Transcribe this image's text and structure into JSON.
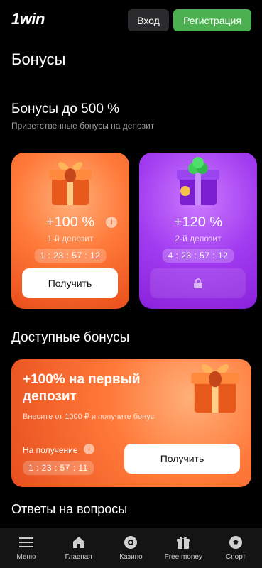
{
  "header": {
    "logo": "1win",
    "login_label": "Вход",
    "register_label": "Регистрация"
  },
  "page_title": "Бонусы",
  "welcome": {
    "title": "Бонусы до 500 %",
    "subtitle": "Приветственные бонусы на депозит",
    "cards": [
      {
        "percent": "+100 %",
        "deposit": "1-й депозит",
        "timer": "1 : 23 : 57 : 12",
        "button": "Получить"
      },
      {
        "percent": "+120 %",
        "deposit": "2-й депозит",
        "timer": "4 : 23 : 57 : 12"
      }
    ]
  },
  "available": {
    "title": "Доступные бонусы",
    "card": {
      "title": "+100% на первый депозит",
      "description": "Внесите от 1000 ₽ и получите бонус",
      "receive_label": "На получение",
      "timer": "1 : 23 : 57 : 11",
      "button": "Получить"
    }
  },
  "faq_title": "Ответы на вопросы",
  "nav": [
    {
      "label": "Меню",
      "icon": "menu-icon"
    },
    {
      "label": "Главная",
      "icon": "home-icon"
    },
    {
      "label": "Казино",
      "icon": "casino-icon"
    },
    {
      "label": "Free money",
      "icon": "gift-icon"
    },
    {
      "label": "Спорт",
      "icon": "soccer-ball-icon"
    }
  ],
  "colors": {
    "register": "#4caf50",
    "orange": "#ff7a3a",
    "purple": "#a23cf0"
  }
}
